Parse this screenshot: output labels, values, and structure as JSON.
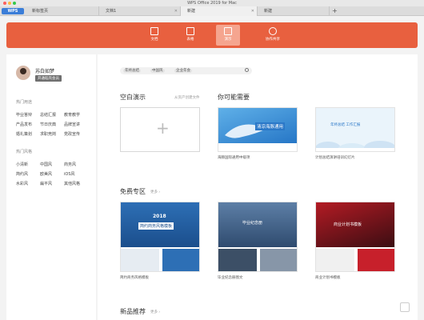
{
  "window": {
    "title": "WPS Office 2019 for Mac"
  },
  "tabs": {
    "wps": "WPS",
    "t1": "新标签页",
    "t2": "文档1",
    "t3": "新建",
    "t4": "新建"
  },
  "ribbon": {
    "text": "文档",
    "sheet": "表格",
    "ppt": "演示",
    "share": "协作共享"
  },
  "user": {
    "name": "苏白如梦",
    "badge": "开通稻壳会员"
  },
  "sidebar": {
    "hot_title": "热门用途",
    "hot_tags": [
      [
        "毕业答辩",
        "总结汇报",
        "教育教学"
      ],
      [
        "产品发布",
        "节日庆典",
        "品牌宣讲"
      ],
      [
        "婚礼策划",
        "求职竞岗",
        "党政宣传"
      ]
    ],
    "style_title": "热门风格",
    "style_tags": [
      [
        "小清新",
        "中国风",
        "商务风"
      ],
      [
        "简约风",
        "欧美风",
        "iOS风"
      ],
      [
        "水彩风",
        "扁平风",
        "其他风格"
      ]
    ]
  },
  "search": {
    "chips": [
      "年终总结",
      "中国风",
      "企业年会"
    ]
  },
  "sections": {
    "blank_title": "空白演示",
    "blank_sub": "从资产创建文件",
    "maybe_title": "你可能需要",
    "free_title": "免费专区",
    "free_more": "更多 ›",
    "new_title": "新品推荐",
    "new_more": "更多 ›"
  },
  "cards": {
    "whale_text": "清凉海豚通用",
    "whale_cap": "海豚国际通用中级项",
    "cloud_text": "年终总结 工作汇报",
    "cloud_cap": "计划总结演讲培训幻灯片",
    "biz_year": "2018",
    "biz_text": "简约商务风格模板",
    "biz_cap": "简约商务风格模板",
    "grad_text": "毕业纪念册",
    "grad_cap": "毕业纪念册图文",
    "plan_text": "商业计划书模板",
    "plan_cap": "商业计划书模板"
  },
  "colors": {
    "ribbon": "#e8603f",
    "accent": "#3b7ed8"
  }
}
